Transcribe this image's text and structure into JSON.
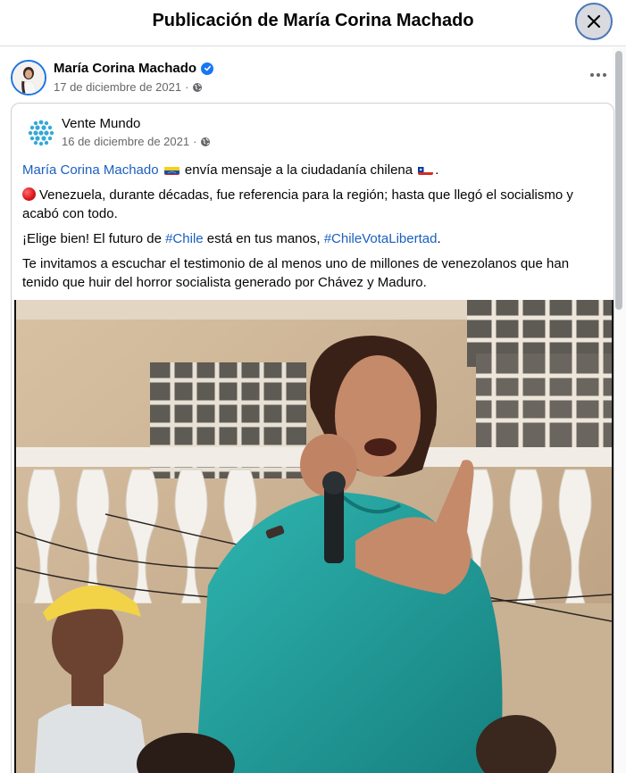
{
  "modal": {
    "title": "Publicación de María Corina Machado"
  },
  "post": {
    "author": "María Corina Machado",
    "date": "17 de diciembre de 2021",
    "shared": {
      "page_name": "Vente Mundo",
      "date": "16 de diciembre de 2021",
      "line1": {
        "mention": "María Corina Machado",
        "text": " envía mensaje a la ciudadanía chilena ",
        "end": "."
      },
      "line2": "Venezuela, durante décadas, fue referencia para la región; hasta que llegó el socialismo y acabó con todo.",
      "line3": {
        "prefix": "¡Elige bien! El futuro de ",
        "hashtag1": "#Chile",
        "middle": " está en tus manos, ",
        "hashtag2": "#ChileVotaLibertad",
        "end": "."
      },
      "line4": "Te invitamos a escuchar el testimonio de al menos uno de millones de venezolanos que han tenido que huir del horror socialista generado por Chávez y Maduro."
    }
  },
  "icons": {
    "close": "close-icon",
    "verified": "verified-badge-icon",
    "globe": "globe-icon",
    "more": "more-options-icon",
    "venezuela_flag": "venezuela-flag-icon",
    "chile_flag": "chile-flag-icon",
    "red_circle": "red-circle-icon"
  },
  "colors": {
    "link": "#1b5fbf",
    "verified": "#1877f2",
    "meta": "#65676b"
  }
}
